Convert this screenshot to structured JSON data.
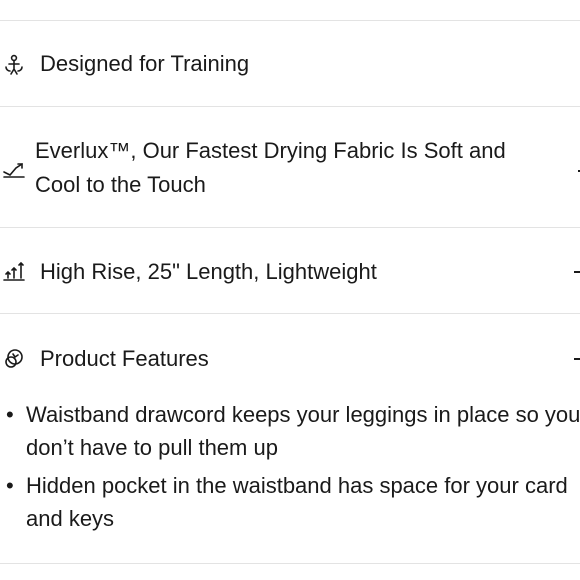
{
  "accordion": {
    "rows": [
      {
        "icon": "weightlifting-icon",
        "label": "Designed for Training"
      },
      {
        "icon": "quick-dry-icon",
        "label": "Everlux™, Our Fastest Drying Fabric Is Soft and Cool to the Touch"
      },
      {
        "icon": "rise-length-icon",
        "label": "High Rise, 25\" Length, Lightweight"
      },
      {
        "icon": "product-features-icon",
        "label": "Product Features"
      }
    ]
  },
  "features": {
    "bullet": "•",
    "items": [
      "Waistband drawcord keeps your leggings in place so you don’t have to pull them up",
      "Hidden pocket in the waistband has space for your card and keys"
    ]
  }
}
